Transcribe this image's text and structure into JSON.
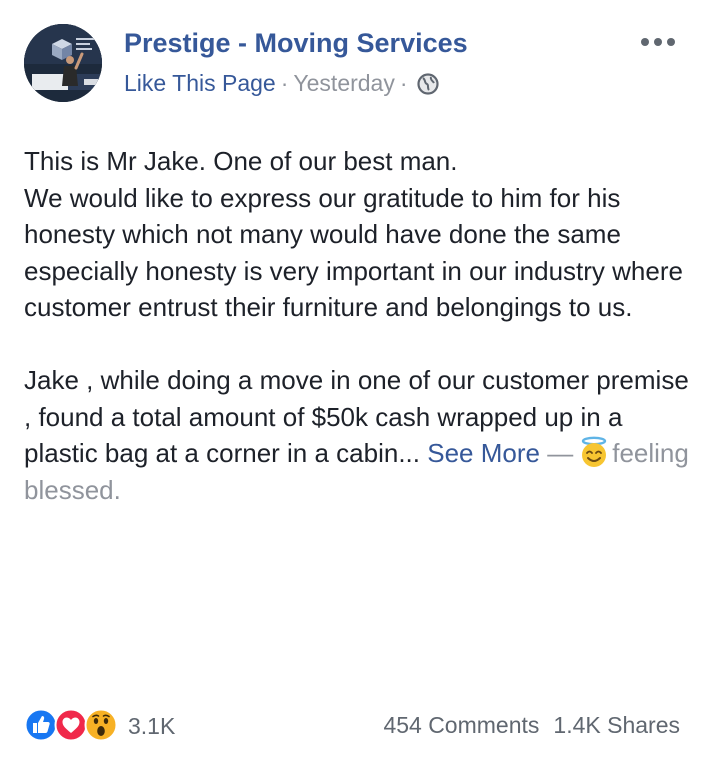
{
  "header": {
    "page_name": "Prestige - Moving Services",
    "like_page_label": "Like This Page",
    "separator": "·",
    "timestamp": "Yesterday",
    "privacy_icon": "globe-icon",
    "more_icon": "more-horizontal-icon"
  },
  "avatar": {
    "sign_text": "Prestige Moving Services"
  },
  "post": {
    "paragraph1_line1": "This is Mr Jake. One of our best man.",
    "paragraph1_rest": "We would like to express our gratitude to him for his honesty which not many would have done the same especially honesty is very important in our industry where customer entrust their furniture and belongings to us.",
    "paragraph2": "Jake , while doing a move in one of our customer premise , found a total amount of $50k cash wrapped up in a plastic bag at a corner in a cabin...",
    "see_more": "See More",
    "dash": "—",
    "feeling_icon": "smiling-halo-icon",
    "feeling": "feeling blessed."
  },
  "footer": {
    "reaction_icons": [
      "like-icon",
      "love-icon",
      "wow-icon"
    ],
    "reaction_count": "3.1K",
    "comments": "454 Comments",
    "shares": "1.4K Shares"
  },
  "colors": {
    "link": "#365899",
    "secondary": "#90949c",
    "text": "#1d2129",
    "like": "#1877f2",
    "love": "#f0284a",
    "wow": "#f7b125"
  }
}
